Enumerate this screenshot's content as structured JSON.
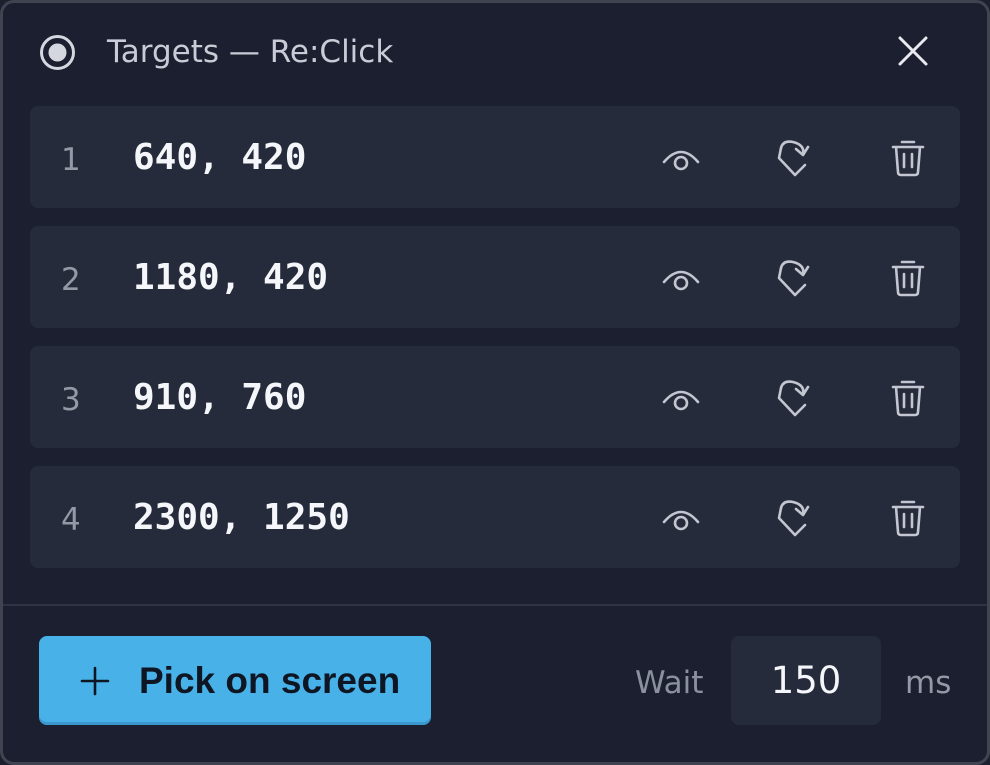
{
  "window": {
    "title": "Targets — Re:Click",
    "accent_color": "#48b2e8"
  },
  "icons": {
    "record": "record-icon",
    "close": "close-icon",
    "preview": "eye-icon",
    "redo": "redo-icon",
    "delete": "trash-icon",
    "add": "plus-icon"
  },
  "targets": [
    {
      "index": "1",
      "coords": "640, 420"
    },
    {
      "index": "2",
      "coords": "1180, 420"
    },
    {
      "index": "3",
      "coords": "910, 760"
    },
    {
      "index": "4",
      "coords": "2300, 1250"
    }
  ],
  "footer": {
    "pick_label": "Pick on screen",
    "wait_label": "Wait",
    "wait_value": "150",
    "unit_label": "ms"
  }
}
